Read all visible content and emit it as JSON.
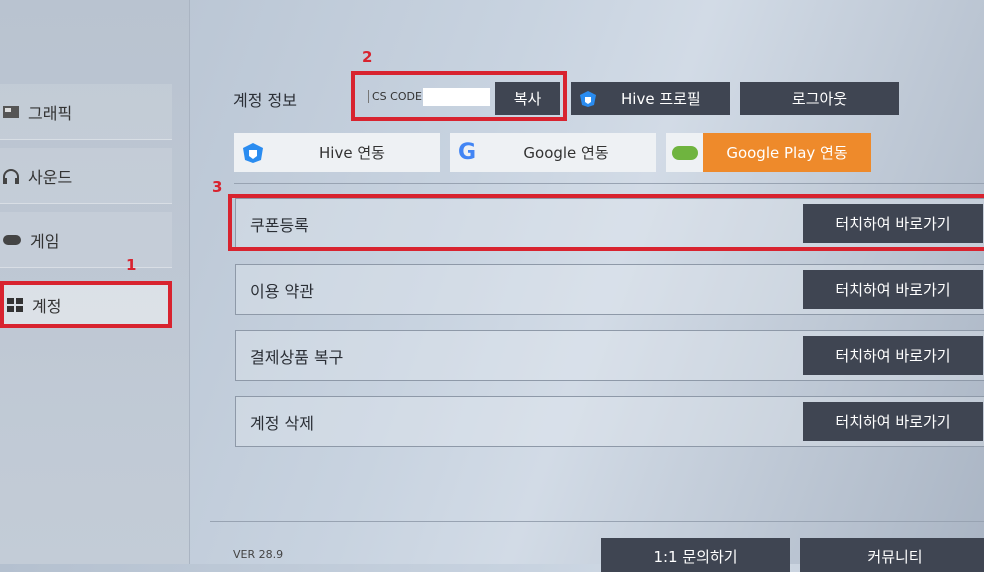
{
  "nav": {
    "back_icon": "chevron-left-icon",
    "home_icon": "home-icon"
  },
  "sidebar": {
    "items": [
      {
        "label": "그래픽",
        "icon": "image-icon"
      },
      {
        "label": "사운드",
        "icon": "headphones-icon"
      },
      {
        "label": "게임",
        "icon": "gamepad-icon"
      },
      {
        "label": "계정",
        "icon": "account-grid-icon",
        "selected": true
      }
    ]
  },
  "annotations": {
    "n1": "1",
    "n2": "2",
    "n3": "3",
    "color": "#d8232f"
  },
  "account": {
    "label": "계정 정보",
    "cs_code_label": "CS CODE :",
    "cs_code_value": "",
    "copy": "복사",
    "hive_profile": "Hive 프로필",
    "logout": "로그아웃"
  },
  "links": {
    "hive": "Hive 연동",
    "google": "Google 연동",
    "google_play": "Google Play 연동",
    "google_play_color": "#ee8a2b"
  },
  "rows": [
    {
      "label": "쿠폰등록",
      "action": "터치하여 바로가기"
    },
    {
      "label": "이용 약관",
      "action": "터치하여 바로가기"
    },
    {
      "label": "결제상품 복구",
      "action": "터치하여 바로가기"
    },
    {
      "label": "계정 삭제",
      "action": "터치하여 바로가기"
    }
  ],
  "footer": {
    "version": "VER 28.9",
    "inquiry": "1:1 문의하기",
    "community": "커뮤니티"
  }
}
